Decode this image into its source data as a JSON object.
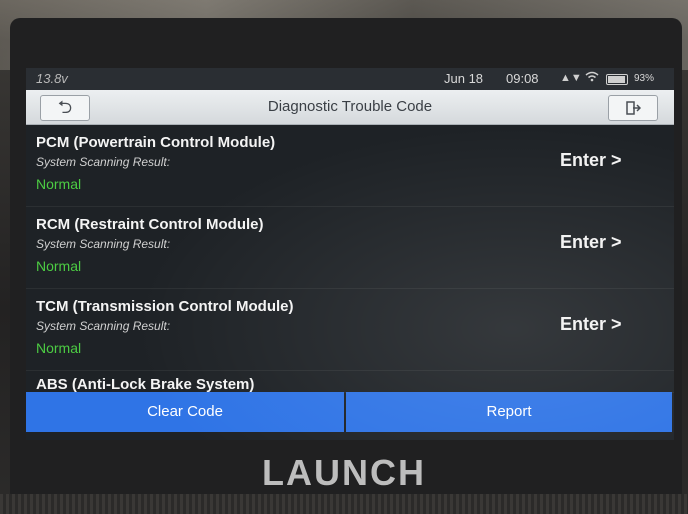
{
  "status_bar": {
    "voltage": "13.8v",
    "date": "Jun 18",
    "time": "09:08",
    "network_icon": "data-signal-icon",
    "wifi_icon": "wifi-icon",
    "battery_icon": "battery-icon",
    "battery_level": 0.93,
    "battery_percent": "93%"
  },
  "header": {
    "title": "Diagnostic Trouble Code",
    "back_icon": "back-arrow-icon",
    "exit_icon": "exit-icon"
  },
  "modules": [
    {
      "name": "PCM (Powertrain Control Module)",
      "scan_label": "System Scanning Result:",
      "status": "Normal",
      "enter": "Enter >"
    },
    {
      "name": "RCM (Restraint Control Module)",
      "scan_label": "System Scanning Result:",
      "status": "Normal",
      "enter": "Enter >"
    },
    {
      "name": "TCM (Transmission Control Module)",
      "scan_label": "System Scanning Result:",
      "status": "Normal",
      "enter": "Enter >"
    },
    {
      "name": "ABS (Anti-Lock Brake System)"
    }
  ],
  "actions": {
    "clear_code": "Clear Code",
    "report": "Report"
  },
  "brand": "LAUNCH",
  "colors": {
    "accent_button": "#2f74e6",
    "status_normal": "#4ccc43"
  }
}
